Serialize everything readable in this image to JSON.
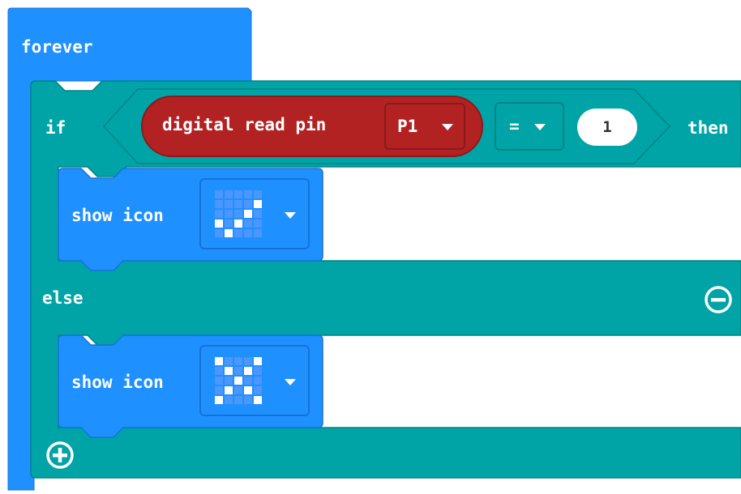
{
  "forever": {
    "label": "forever"
  },
  "if_block": {
    "if_label": "if",
    "then_label": "then",
    "else_label": "else",
    "condition": {
      "function_label": "digital read pin",
      "pin_value": "P1",
      "operator": "=",
      "compare_value": "1"
    }
  },
  "then_branch": {
    "show_icon_label": "show icon",
    "icon": "yes-checkmark-icon",
    "icon_grid": [
      [
        0,
        0,
        0,
        0,
        0
      ],
      [
        0,
        0,
        0,
        0,
        1
      ],
      [
        0,
        0,
        0,
        1,
        0
      ],
      [
        1,
        0,
        1,
        0,
        0
      ],
      [
        0,
        1,
        0,
        0,
        0
      ]
    ]
  },
  "else_branch": {
    "show_icon_label": "show icon",
    "icon": "no-x-icon",
    "icon_grid": [
      [
        1,
        0,
        0,
        0,
        1
      ],
      [
        0,
        1,
        0,
        1,
        0
      ],
      [
        0,
        0,
        1,
        0,
        0
      ],
      [
        0,
        1,
        0,
        1,
        0
      ],
      [
        1,
        0,
        0,
        0,
        1
      ]
    ]
  },
  "colors": {
    "basic_blue": "#1E90FF",
    "logic_teal": "#00A4A6",
    "pins_red": "#B22222",
    "dark_red": "#8B1A1A",
    "led_on": "#ffffff",
    "led_off": "#4C97FF"
  }
}
